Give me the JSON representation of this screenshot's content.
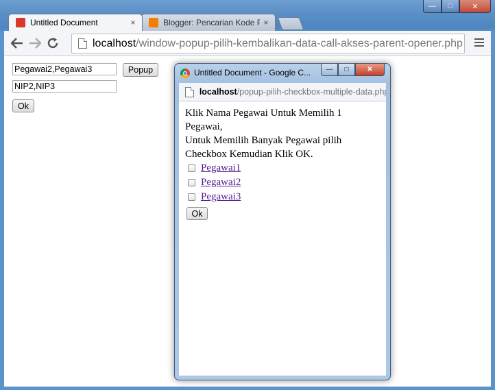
{
  "browser": {
    "tabs": [
      {
        "title": "Untitled Document",
        "close": "×",
        "favicon_color": "#d9382f"
      },
      {
        "title": "Blogger: Pencarian Kode P",
        "close": "×",
        "favicon_color": "#f57d00"
      }
    ],
    "url_host": "localhost",
    "url_path": "/window-popup-pilih-kembalikan-data-call-akses-parent-opener.php",
    "window_controls": {
      "minimize": "—",
      "maximize": "□",
      "close": "✕"
    }
  },
  "page": {
    "nama_value": "Pegawai2,Pegawai3",
    "popup_button": "Popup",
    "nip_value": "NIP2,NIP3",
    "ok_button": "Ok"
  },
  "popup": {
    "window_title": "Untitled Document - Google C...",
    "url_host": "localhost",
    "url_path": "/popup-pilih-checkbox-multiple-data.php",
    "instruction_line1": "Klik Nama Pegawai Untuk Memilih 1 Pegawai,",
    "instruction_line2": "Untuk Memilih Banyak Pegawai pilih Checkbox Kemudian Klik OK.",
    "items": [
      {
        "label": "Pegawai1",
        "checked": false
      },
      {
        "label": "Pegawai2",
        "checked": false
      },
      {
        "label": "Pegawai3",
        "checked": false
      }
    ],
    "ok_button": "Ok"
  }
}
